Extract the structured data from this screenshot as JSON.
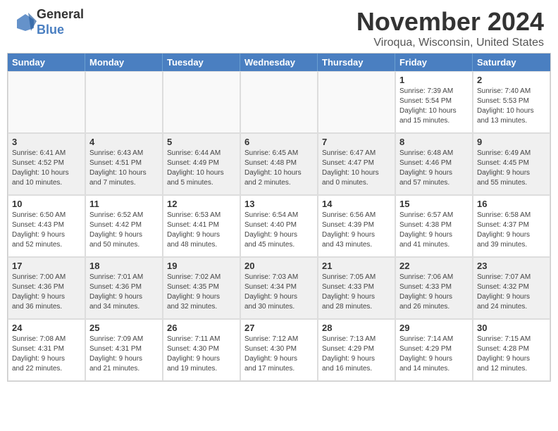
{
  "header": {
    "title": "November 2024",
    "location": "Viroqua, Wisconsin, United States",
    "logo_line1": "General",
    "logo_line2": "Blue"
  },
  "weekdays": [
    "Sunday",
    "Monday",
    "Tuesday",
    "Wednesday",
    "Thursday",
    "Friday",
    "Saturday"
  ],
  "cells": [
    {
      "day": "",
      "info": "",
      "empty": true
    },
    {
      "day": "",
      "info": "",
      "empty": true
    },
    {
      "day": "",
      "info": "",
      "empty": true
    },
    {
      "day": "",
      "info": "",
      "empty": true
    },
    {
      "day": "",
      "info": "",
      "empty": true
    },
    {
      "day": "1",
      "info": "Sunrise: 7:39 AM\nSunset: 5:54 PM\nDaylight: 10 hours\nand 15 minutes.",
      "empty": false
    },
    {
      "day": "2",
      "info": "Sunrise: 7:40 AM\nSunset: 5:53 PM\nDaylight: 10 hours\nand 13 minutes.",
      "empty": false
    },
    {
      "day": "3",
      "info": "Sunrise: 6:41 AM\nSunset: 4:52 PM\nDaylight: 10 hours\nand 10 minutes.",
      "empty": false
    },
    {
      "day": "4",
      "info": "Sunrise: 6:43 AM\nSunset: 4:51 PM\nDaylight: 10 hours\nand 7 minutes.",
      "empty": false
    },
    {
      "day": "5",
      "info": "Sunrise: 6:44 AM\nSunset: 4:49 PM\nDaylight: 10 hours\nand 5 minutes.",
      "empty": false
    },
    {
      "day": "6",
      "info": "Sunrise: 6:45 AM\nSunset: 4:48 PM\nDaylight: 10 hours\nand 2 minutes.",
      "empty": false
    },
    {
      "day": "7",
      "info": "Sunrise: 6:47 AM\nSunset: 4:47 PM\nDaylight: 10 hours\nand 0 minutes.",
      "empty": false
    },
    {
      "day": "8",
      "info": "Sunrise: 6:48 AM\nSunset: 4:46 PM\nDaylight: 9 hours\nand 57 minutes.",
      "empty": false
    },
    {
      "day": "9",
      "info": "Sunrise: 6:49 AM\nSunset: 4:45 PM\nDaylight: 9 hours\nand 55 minutes.",
      "empty": false
    },
    {
      "day": "10",
      "info": "Sunrise: 6:50 AM\nSunset: 4:43 PM\nDaylight: 9 hours\nand 52 minutes.",
      "empty": false
    },
    {
      "day": "11",
      "info": "Sunrise: 6:52 AM\nSunset: 4:42 PM\nDaylight: 9 hours\nand 50 minutes.",
      "empty": false
    },
    {
      "day": "12",
      "info": "Sunrise: 6:53 AM\nSunset: 4:41 PM\nDaylight: 9 hours\nand 48 minutes.",
      "empty": false
    },
    {
      "day": "13",
      "info": "Sunrise: 6:54 AM\nSunset: 4:40 PM\nDaylight: 9 hours\nand 45 minutes.",
      "empty": false
    },
    {
      "day": "14",
      "info": "Sunrise: 6:56 AM\nSunset: 4:39 PM\nDaylight: 9 hours\nand 43 minutes.",
      "empty": false
    },
    {
      "day": "15",
      "info": "Sunrise: 6:57 AM\nSunset: 4:38 PM\nDaylight: 9 hours\nand 41 minutes.",
      "empty": false
    },
    {
      "day": "16",
      "info": "Sunrise: 6:58 AM\nSunset: 4:37 PM\nDaylight: 9 hours\nand 39 minutes.",
      "empty": false
    },
    {
      "day": "17",
      "info": "Sunrise: 7:00 AM\nSunset: 4:36 PM\nDaylight: 9 hours\nand 36 minutes.",
      "empty": false
    },
    {
      "day": "18",
      "info": "Sunrise: 7:01 AM\nSunset: 4:36 PM\nDaylight: 9 hours\nand 34 minutes.",
      "empty": false
    },
    {
      "day": "19",
      "info": "Sunrise: 7:02 AM\nSunset: 4:35 PM\nDaylight: 9 hours\nand 32 minutes.",
      "empty": false
    },
    {
      "day": "20",
      "info": "Sunrise: 7:03 AM\nSunset: 4:34 PM\nDaylight: 9 hours\nand 30 minutes.",
      "empty": false
    },
    {
      "day": "21",
      "info": "Sunrise: 7:05 AM\nSunset: 4:33 PM\nDaylight: 9 hours\nand 28 minutes.",
      "empty": false
    },
    {
      "day": "22",
      "info": "Sunrise: 7:06 AM\nSunset: 4:33 PM\nDaylight: 9 hours\nand 26 minutes.",
      "empty": false
    },
    {
      "day": "23",
      "info": "Sunrise: 7:07 AM\nSunset: 4:32 PM\nDaylight: 9 hours\nand 24 minutes.",
      "empty": false
    },
    {
      "day": "24",
      "info": "Sunrise: 7:08 AM\nSunset: 4:31 PM\nDaylight: 9 hours\nand 22 minutes.",
      "empty": false
    },
    {
      "day": "25",
      "info": "Sunrise: 7:09 AM\nSunset: 4:31 PM\nDaylight: 9 hours\nand 21 minutes.",
      "empty": false
    },
    {
      "day": "26",
      "info": "Sunrise: 7:11 AM\nSunset: 4:30 PM\nDaylight: 9 hours\nand 19 minutes.",
      "empty": false
    },
    {
      "day": "27",
      "info": "Sunrise: 7:12 AM\nSunset: 4:30 PM\nDaylight: 9 hours\nand 17 minutes.",
      "empty": false
    },
    {
      "day": "28",
      "info": "Sunrise: 7:13 AM\nSunset: 4:29 PM\nDaylight: 9 hours\nand 16 minutes.",
      "empty": false
    },
    {
      "day": "29",
      "info": "Sunrise: 7:14 AM\nSunset: 4:29 PM\nDaylight: 9 hours\nand 14 minutes.",
      "empty": false
    },
    {
      "day": "30",
      "info": "Sunrise: 7:15 AM\nSunset: 4:28 PM\nDaylight: 9 hours\nand 12 minutes.",
      "empty": false
    }
  ]
}
